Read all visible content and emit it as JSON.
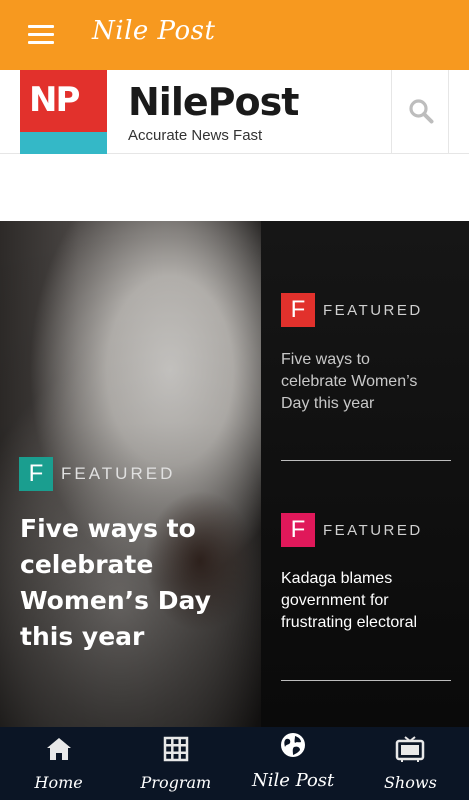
{
  "app_bar": {
    "title": "Nile Post",
    "menu_icon": "hamburger-menu-icon",
    "background": "#f7991f"
  },
  "site_header": {
    "logo_mark": "NP",
    "logo_name": "NilePost",
    "tagline": "Accurate News Fast",
    "search_icon": "search-icon",
    "logo_colors": {
      "red": "#e2312c",
      "teal": "#34b8c7"
    }
  },
  "hero": {
    "main_story": {
      "badge_letter": "F",
      "badge_color": "#1a9e8f",
      "category": "FEATURED",
      "headline": " Five ways to\ncelebrate\nWomen’s Day\nthis year"
    },
    "side_stories": [
      {
        "badge_letter": "F",
        "badge_color": "#e2312c",
        "category": "FEATURED",
        "headline": " Five ways to\ncelebrate Women’s\nDay this year",
        "headline_color": "#c8c8c8"
      },
      {
        "badge_letter": "F",
        "badge_color": "#e0185a",
        "category": "FEATURED",
        "headline": "Kadaga blames\ngovernment for\nfrustrating electoral",
        "headline_color": "#ffffff"
      }
    ]
  },
  "bottom_nav": {
    "items": [
      {
        "label": "Home",
        "icon": "home-icon"
      },
      {
        "label": "Program",
        "icon": "grid-icon"
      },
      {
        "label": "Nile Post",
        "icon": "globe-icon",
        "active": true
      },
      {
        "label": "Shows",
        "icon": "tv-icon"
      }
    ],
    "background": "#0b1525"
  }
}
